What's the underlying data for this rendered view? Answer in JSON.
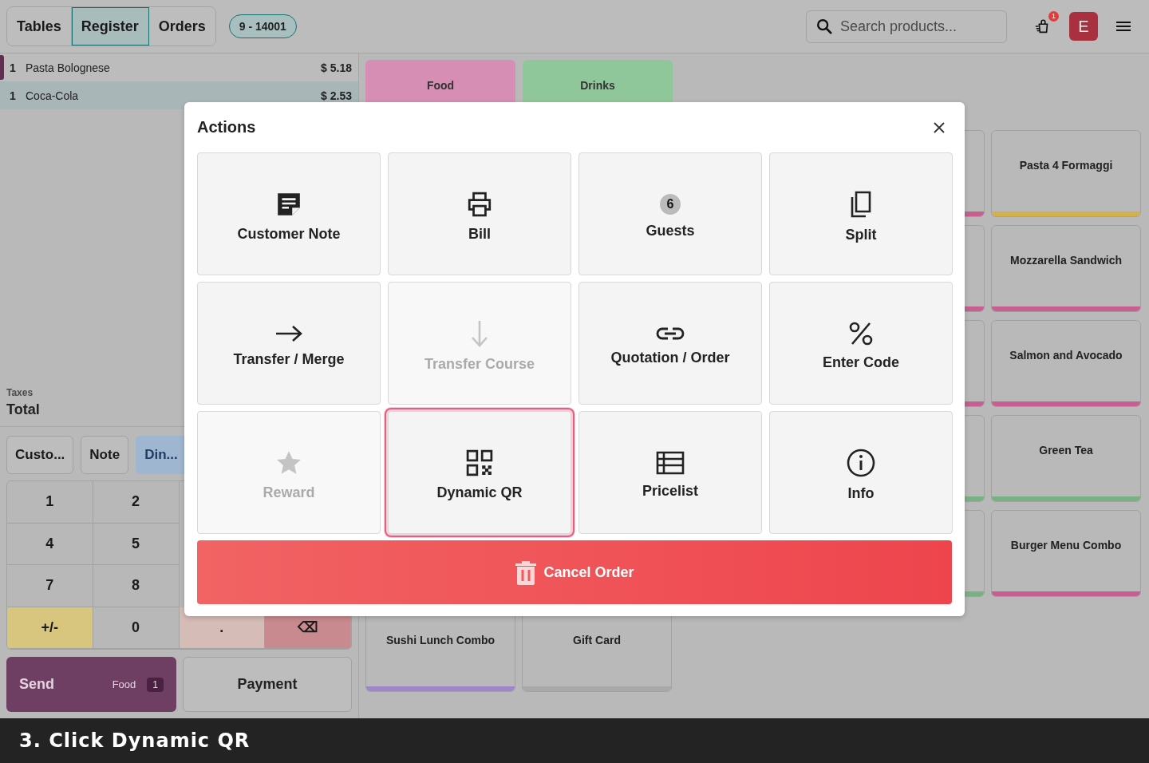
{
  "nav": {
    "tabs": [
      {
        "label": "Tables",
        "selected": false
      },
      {
        "label": "Register",
        "selected": true
      },
      {
        "label": "Orders",
        "selected": false
      }
    ],
    "order_badge": "9 - 14001",
    "search": {
      "placeholder": "Search products..."
    },
    "notification_count": "1",
    "avatar": "E"
  },
  "order_lines": [
    {
      "qty": "1",
      "name": "Pasta Bolognese",
      "price": "$ 5.18",
      "selected": false,
      "pending": true
    },
    {
      "qty": "1",
      "name": "Coca-Cola",
      "price": "$ 2.53",
      "selected": true,
      "pending": false
    }
  ],
  "totals": {
    "taxes_label": "Taxes",
    "total_label": "Total"
  },
  "control_buttons": [
    {
      "label": "Custo...",
      "selected": false
    },
    {
      "label": "Note",
      "selected": false
    },
    {
      "label": "Din...",
      "selected": true
    }
  ],
  "numpad": [
    {
      "label": "1",
      "kind": "digit"
    },
    {
      "label": "2",
      "kind": "digit"
    },
    {
      "label": "4",
      "kind": "digit"
    },
    {
      "label": "5",
      "kind": "digit"
    },
    {
      "label": "7",
      "kind": "digit"
    },
    {
      "label": "8",
      "kind": "digit"
    },
    {
      "label": "+/-",
      "kind": "sign"
    },
    {
      "label": "0",
      "kind": "digit"
    },
    {
      "label": ".",
      "kind": "dot"
    },
    {
      "label": "⌫",
      "kind": "backspace"
    }
  ],
  "send_button": {
    "label": "Send",
    "category": "Food",
    "count": "1"
  },
  "payment_button": {
    "label": "Payment"
  },
  "categories": [
    {
      "label": "Food",
      "color": "#d68eb5"
    },
    {
      "label": "Drinks",
      "color": "#90c79a"
    }
  ],
  "products": [
    {
      "color": "#c75f91"
    },
    {
      "name": "Pasta 4 Formaggi",
      "color": "#d4b04a"
    },
    {
      "color": "#c75f91"
    },
    {
      "name": "Mozzarella Sandwich",
      "color": "#c75f91"
    },
    {
      "color": "#c75f91"
    },
    {
      "name": "Salmon and Avocado",
      "color": "#c75f91"
    },
    {
      "color": "#77b283"
    },
    {
      "name": "Green Tea",
      "color": "#77b283"
    },
    {
      "color": "#77b283"
    },
    {
      "name": "Burger Menu Combo",
      "color": "#c75f91"
    },
    {
      "name": "Sushi Lunch Combo",
      "color": "#9d86cc"
    },
    {
      "name": "Gift Card",
      "color": "#a8a8a8"
    }
  ],
  "dialog": {
    "title": "Actions",
    "actions": [
      {
        "label": "Customer Note",
        "kind": "note",
        "disabled": false,
        "selected": false
      },
      {
        "label": "Bill",
        "kind": "printer",
        "disabled": false,
        "selected": false
      },
      {
        "label": "Guests",
        "kind": "guests",
        "count": "6",
        "disabled": false,
        "selected": false
      },
      {
        "label": "Split",
        "kind": "copy",
        "disabled": false,
        "selected": false
      },
      {
        "label": "Transfer / Merge",
        "kind": "arrow-right",
        "disabled": false,
        "selected": false
      },
      {
        "label": "Transfer Course",
        "kind": "arrow-down",
        "disabled": true,
        "selected": false
      },
      {
        "label": "Quotation / Order",
        "kind": "link",
        "disabled": false,
        "selected": false
      },
      {
        "label": "Enter Code",
        "kind": "percent",
        "disabled": false,
        "selected": false
      },
      {
        "label": "Reward",
        "kind": "star",
        "disabled": true,
        "selected": false
      },
      {
        "label": "Dynamic QR",
        "kind": "qr",
        "disabled": false,
        "selected": true
      },
      {
        "label": "Pricelist",
        "kind": "list",
        "disabled": false,
        "selected": false
      },
      {
        "label": "Info",
        "kind": "info",
        "disabled": false,
        "selected": false
      }
    ],
    "cancel_button": "Cancel Order"
  },
  "caption": "3. Click Dynamic QR"
}
